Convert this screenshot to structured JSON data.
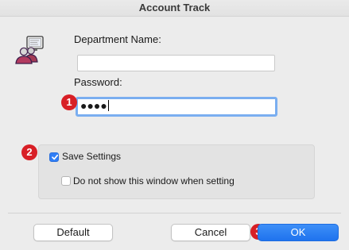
{
  "window": {
    "title": "Account Track"
  },
  "form": {
    "department_label": "Department Name:",
    "department_value": "",
    "password_label": "Password:",
    "password_value": "●●●●"
  },
  "settings": {
    "save_settings_label": "Save Settings",
    "save_settings_checked": true,
    "do_not_show_label": "Do not show this window when setting",
    "do_not_show_checked": false
  },
  "buttons": {
    "default_label": "Default",
    "cancel_label": "Cancel",
    "ok_label": "OK"
  },
  "annotations": {
    "step1": "1",
    "step2": "2",
    "step3": "3"
  },
  "icons": {
    "app_icon": "users-monitor-icon",
    "badge_color": "#d81f26",
    "accent_color": "#2f7ef6"
  }
}
